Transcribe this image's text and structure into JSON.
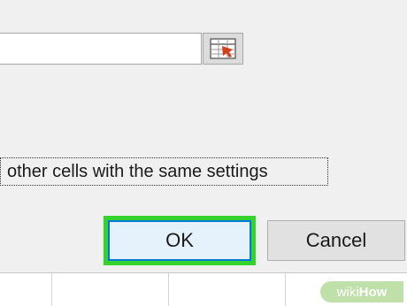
{
  "dialog": {
    "reference_input": {
      "value": ""
    },
    "reference_button": {
      "icon": "collapse-dialog-icon"
    },
    "checkbox": {
      "label": "other cells with the same settings",
      "checked": false
    },
    "ok_button": {
      "label": "OK"
    },
    "cancel_button": {
      "label": "Cancel"
    }
  },
  "watermark": {
    "part1": "wiki",
    "part2": "How"
  },
  "colors": {
    "highlight": "#35d42d",
    "ok_border": "#0078d7",
    "ok_fill": "#e5f1fb",
    "dialog_bg": "#f0f0f0"
  }
}
